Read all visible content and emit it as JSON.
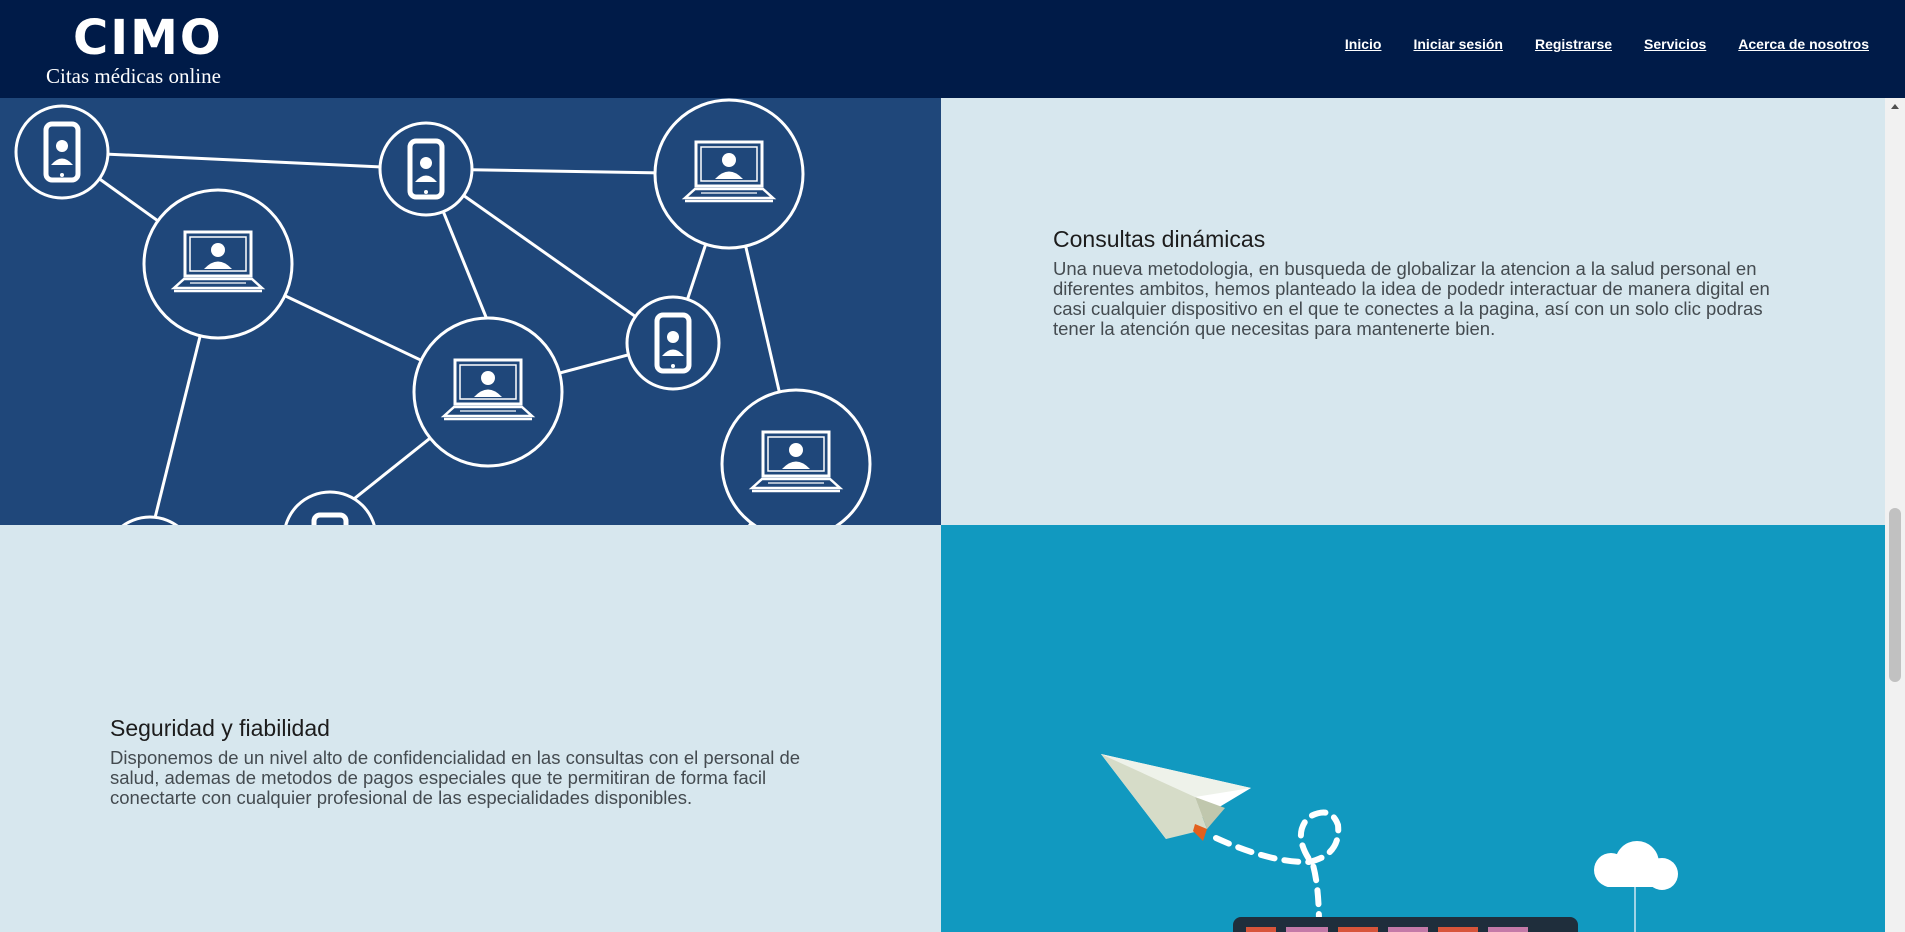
{
  "brand": {
    "name": "CIMO",
    "tagline": "Citas médicas online"
  },
  "nav": [
    "Inicio",
    "Iniciar sesión",
    "Registrarse",
    "Servicios",
    "Acerca de nosotros"
  ],
  "features": [
    {
      "title": "Consultas dinámicas",
      "text": "Una nueva metodologia, en busqueda de globalizar la atencion a la salud personal en diferentes ambitos, hemos planteado la idea de podedr interactuar de manera digital en casi cualquier dispositivo en el que te conectes a la pagina, así con un solo clic podras tener la atención que necesitas para mantenerte bien."
    },
    {
      "title": "Seguridad y fiabilidad",
      "text": "Disponemos de un nivel alto de confidencialidad en las consultas con el personal de salud, ademas de metodos de pagos especiales que te permitiran de forma facil conectarte con cualquier profesional de las especialidades disponibles."
    }
  ],
  "colors": {
    "header": "#001b48",
    "network_bg": "#1f477a",
    "light_panel": "#d7e7ee",
    "teal_panel": "#1199c0"
  },
  "icons": [
    "phone-icon",
    "laptop-user-icon",
    "paper-plane-icon",
    "cloud-icon"
  ]
}
